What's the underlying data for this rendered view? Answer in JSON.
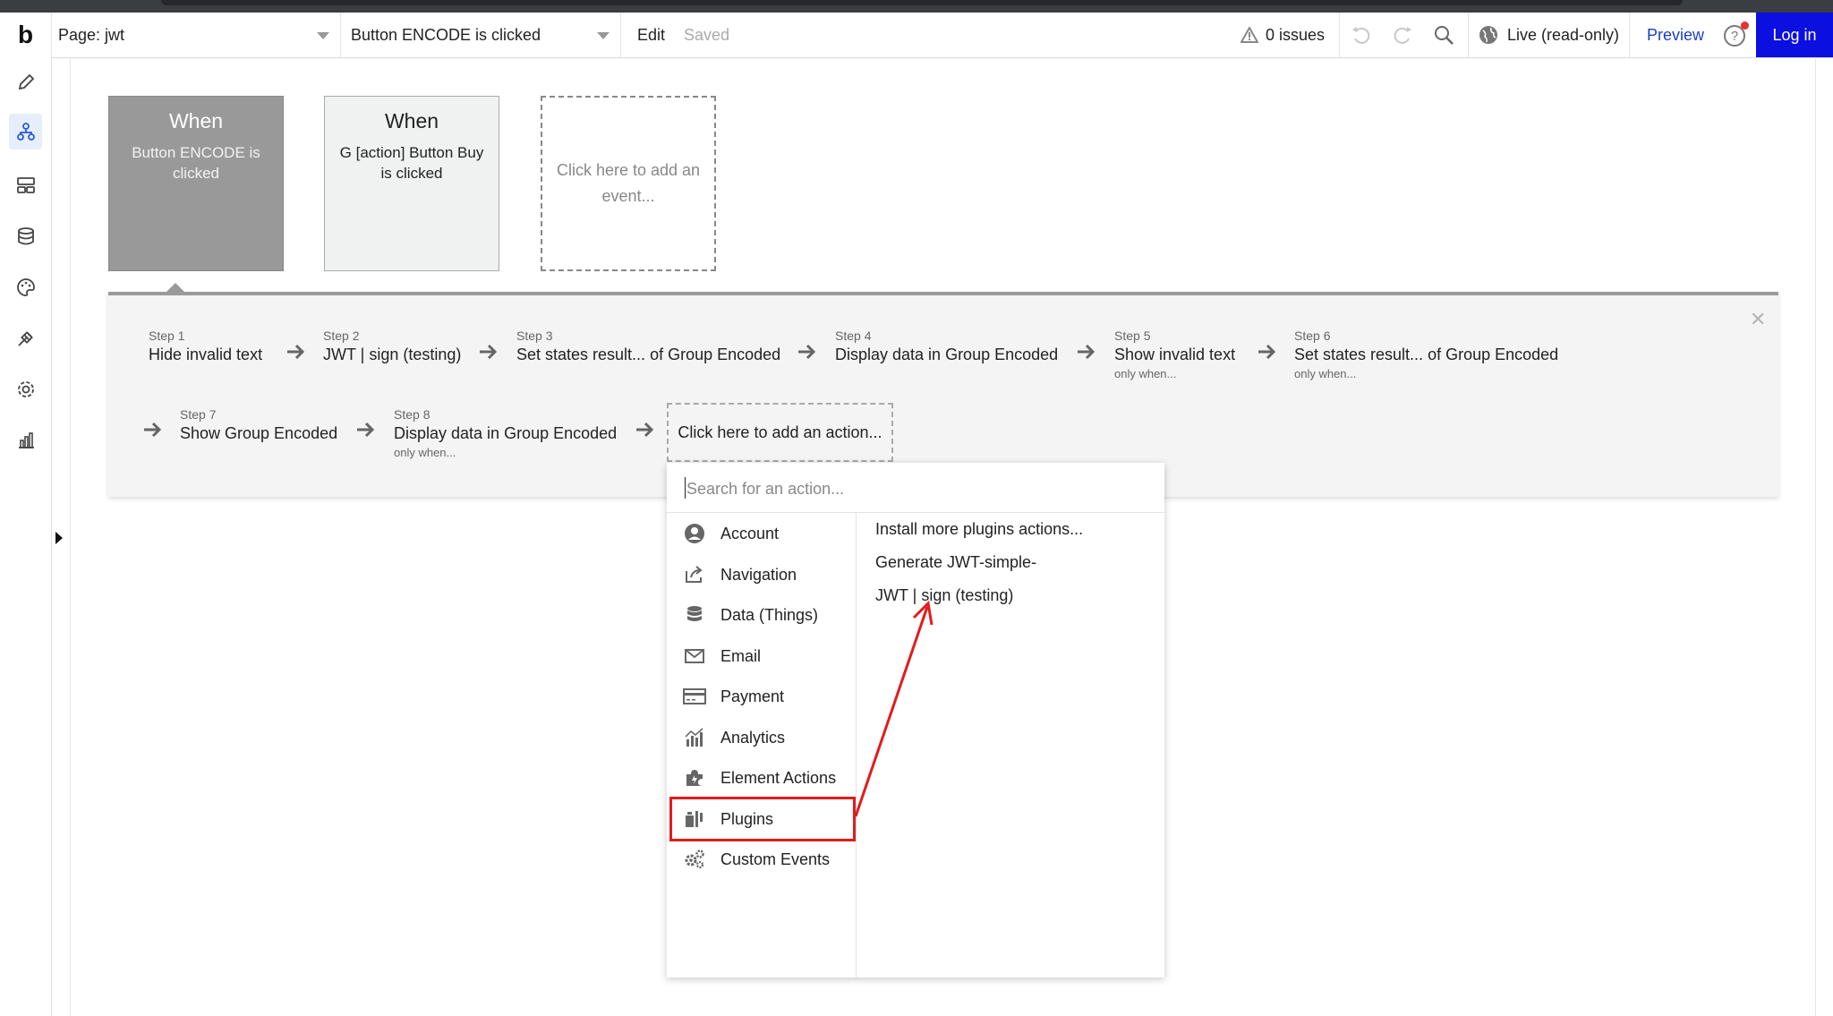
{
  "topbar": {
    "logo": "b",
    "page_selector": "Page: jwt",
    "event_selector": "Button ENCODE is clicked",
    "edit": "Edit",
    "saved": "Saved",
    "issues": "0 issues",
    "live": "Live (read-only)",
    "preview": "Preview",
    "login": "Log in"
  },
  "events": [
    {
      "when": "When",
      "desc": "Button ENCODE is clicked"
    },
    {
      "when": "When",
      "desc": "G [action] Button Buy is clicked"
    },
    {
      "add": "Click here to add an event..."
    }
  ],
  "steps": [
    {
      "num": "Step 1",
      "title": "Hide invalid text",
      "cond": ""
    },
    {
      "num": "Step 2",
      "title": "JWT | sign (testing)",
      "cond": ""
    },
    {
      "num": "Step 3",
      "title": "Set states result... of Group Encoded",
      "cond": ""
    },
    {
      "num": "Step 4",
      "title": "Display data in Group Encoded",
      "cond": ""
    },
    {
      "num": "Step 5",
      "title": "Show invalid text",
      "cond": "only when..."
    },
    {
      "num": "Step 6",
      "title": "Set states result... of Group Encoded",
      "cond": "only when..."
    },
    {
      "num": "Step 7",
      "title": "Show Group Encoded",
      "cond": ""
    },
    {
      "num": "Step 8",
      "title": "Display data in Group Encoded",
      "cond": "only when..."
    }
  ],
  "add_action": "Click here to add an action...",
  "menu": {
    "search_placeholder": "Search for an action...",
    "categories": [
      {
        "label": "Account",
        "icon": "account-icon"
      },
      {
        "label": "Navigation",
        "icon": "navigation-icon"
      },
      {
        "label": "Data (Things)",
        "icon": "database-icon"
      },
      {
        "label": "Email",
        "icon": "email-icon"
      },
      {
        "label": "Payment",
        "icon": "payment-icon"
      },
      {
        "label": "Analytics",
        "icon": "analytics-icon"
      },
      {
        "label": "Element Actions",
        "icon": "element-actions-icon"
      },
      {
        "label": "Plugins",
        "icon": "plugins-icon"
      },
      {
        "label": "Custom Events",
        "icon": "custom-events-icon"
      }
    ],
    "plugin_actions": [
      "Install more plugins actions...",
      "Generate JWT-simple-",
      "JWT | sign (testing)"
    ]
  },
  "colors": {
    "login_bg": "#0b0fe0",
    "preview_text": "#1a3fc4",
    "annotation": "#e31b1b",
    "selected_event_bg": "#999999"
  }
}
